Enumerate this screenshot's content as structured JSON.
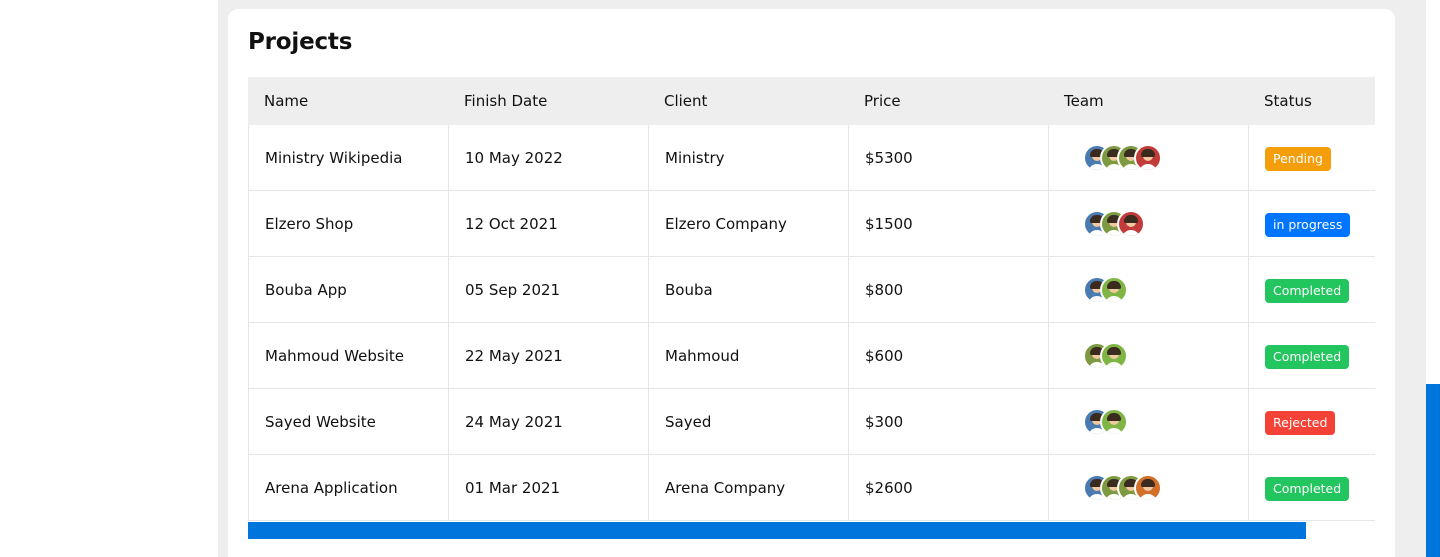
{
  "title": "Projects",
  "columns": [
    "Name",
    "Finish Date",
    "Client",
    "Price",
    "Team",
    "Status"
  ],
  "rows": [
    {
      "name": "Ministry Wikipedia",
      "date": "10 May 2022",
      "client": "Ministry",
      "price": "$5300",
      "team": [
        "blue",
        "olive",
        "olive",
        "red"
      ],
      "status": "Pending",
      "status_color": "#f59e0b"
    },
    {
      "name": "Elzero Shop",
      "date": "12 Oct 2021",
      "client": "Elzero Company",
      "price": "$1500",
      "team": [
        "blue",
        "olive",
        "red"
      ],
      "status": "in progress",
      "status_color": "#0075ff"
    },
    {
      "name": "Bouba App",
      "date": "05 Sep 2021",
      "client": "Bouba",
      "price": "$800",
      "team": [
        "blue",
        "green"
      ],
      "status": "Completed",
      "status_color": "#22c55e"
    },
    {
      "name": "Mahmoud Website",
      "date": "22 May 2021",
      "client": "Mahmoud",
      "price": "$600",
      "team": [
        "olive",
        "green"
      ],
      "status": "Completed",
      "status_color": "#22c55e"
    },
    {
      "name": "Sayed Website",
      "date": "24 May 2021",
      "client": "Sayed",
      "price": "$300",
      "team": [
        "blue",
        "green"
      ],
      "status": "Rejected",
      "status_color": "#f44336"
    },
    {
      "name": "Arena Application",
      "date": "01 Mar 2021",
      "client": "Arena Company",
      "price": "$2600",
      "team": [
        "blue",
        "olive",
        "olive",
        "orange"
      ],
      "status": "Completed",
      "status_color": "#22c55e"
    }
  ],
  "colors": {
    "accent": "#0075db",
    "page_bg": "#eeeeee",
    "card_bg": "#ffffff"
  }
}
